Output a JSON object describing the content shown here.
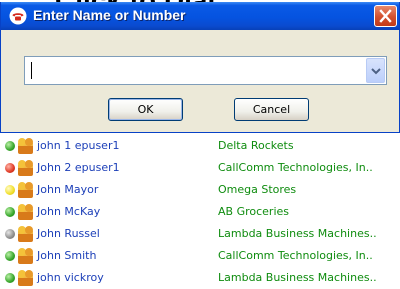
{
  "background": {
    "heading": "Click to Dial"
  },
  "dialog": {
    "title": "Enter Name or Number",
    "input_value": "",
    "ok_label": "OK",
    "cancel_label": "Cancel"
  },
  "contacts": [
    {
      "name": "john 1 epuser1",
      "company": "Delta Rockets",
      "status": "green"
    },
    {
      "name": "John 2 epuser1",
      "company": "CallComm Technologies, In..",
      "status": "red"
    },
    {
      "name": "John Mayor",
      "company": "Omega Stores",
      "status": "yellow"
    },
    {
      "name": "John McKay",
      "company": "AB Groceries",
      "status": "green"
    },
    {
      "name": "John Russel",
      "company": "Lambda Business Machines..",
      "status": "gray"
    },
    {
      "name": "John Smith",
      "company": "CallComm Technologies, In..",
      "status": "green"
    },
    {
      "name": "john vickroy",
      "company": "Lambda Business Machines..",
      "status": "green"
    }
  ],
  "colors": {
    "titlebar": "#0553e0",
    "name_text": "#1c3fb8",
    "company_text": "#0f8c0f"
  },
  "icons": {
    "title": "telephone-icon",
    "close": "close-icon",
    "dropdown": "chevron-down-icon",
    "contact": "contact-card-icon"
  }
}
